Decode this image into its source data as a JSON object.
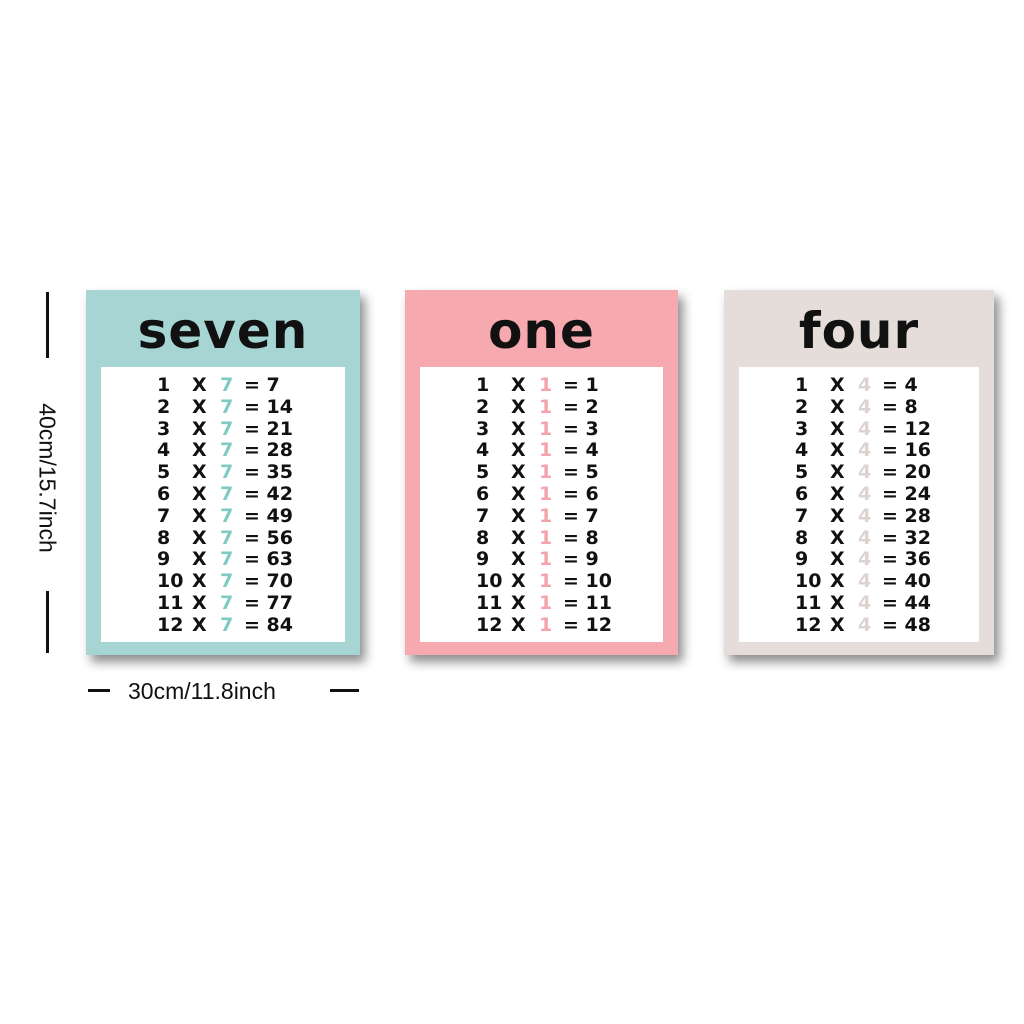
{
  "posters": [
    {
      "title": "seven",
      "bg_color": "#a6d5d3",
      "accent_color": "#7fcac4",
      "rows": [
        {
          "a": "1",
          "x": "X",
          "b": "7",
          "result": "= 7"
        },
        {
          "a": "2",
          "x": "X",
          "b": "7",
          "result": "= 14"
        },
        {
          "a": "3",
          "x": "X",
          "b": "7",
          "result": "= 21"
        },
        {
          "a": "4",
          "x": "X",
          "b": "7",
          "result": "= 28"
        },
        {
          "a": "5",
          "x": "X",
          "b": "7",
          "result": "= 35"
        },
        {
          "a": "6",
          "x": "X",
          "b": "7",
          "result": "= 42"
        },
        {
          "a": "7",
          "x": "X",
          "b": "7",
          "result": "= 49"
        },
        {
          "a": "8",
          "x": "X",
          "b": "7",
          "result": "= 56"
        },
        {
          "a": "9",
          "x": "X",
          "b": "7",
          "result": "= 63"
        },
        {
          "a": "10",
          "x": "X",
          "b": "7",
          "result": "= 70"
        },
        {
          "a": "11",
          "x": "X",
          "b": "7",
          "result": "= 77"
        },
        {
          "a": "12",
          "x": "X",
          "b": "7",
          "result": "= 84"
        }
      ]
    },
    {
      "title": "one",
      "bg_color": "#f7a9b0",
      "accent_color": "#f4a3ab",
      "rows": [
        {
          "a": "1",
          "x": "X",
          "b": "1",
          "result": "= 1"
        },
        {
          "a": "2",
          "x": "X",
          "b": "1",
          "result": "= 2"
        },
        {
          "a": "3",
          "x": "X",
          "b": "1",
          "result": "= 3"
        },
        {
          "a": "4",
          "x": "X",
          "b": "1",
          "result": "= 4"
        },
        {
          "a": "5",
          "x": "X",
          "b": "1",
          "result": "= 5"
        },
        {
          "a": "6",
          "x": "X",
          "b": "1",
          "result": "= 6"
        },
        {
          "a": "7",
          "x": "X",
          "b": "1",
          "result": "= 7"
        },
        {
          "a": "8",
          "x": "X",
          "b": "1",
          "result": "= 8"
        },
        {
          "a": "9",
          "x": "X",
          "b": "1",
          "result": "= 9"
        },
        {
          "a": "10",
          "x": "X",
          "b": "1",
          "result": "= 10"
        },
        {
          "a": "11",
          "x": "X",
          "b": "1",
          "result": "= 11"
        },
        {
          "a": "12",
          "x": "X",
          "b": "1",
          "result": "= 12"
        }
      ]
    },
    {
      "title": "four",
      "bg_color": "#e4ddda",
      "accent_color": "#ddd3d0",
      "rows": [
        {
          "a": "1",
          "x": "X",
          "b": "4",
          "result": "= 4"
        },
        {
          "a": "2",
          "x": "X",
          "b": "4",
          "result": "= 8"
        },
        {
          "a": "3",
          "x": "X",
          "b": "4",
          "result": "= 12"
        },
        {
          "a": "4",
          "x": "X",
          "b": "4",
          "result": "= 16"
        },
        {
          "a": "5",
          "x": "X",
          "b": "4",
          "result": "= 20"
        },
        {
          "a": "6",
          "x": "X",
          "b": "4",
          "result": "= 24"
        },
        {
          "a": "7",
          "x": "X",
          "b": "4",
          "result": "= 28"
        },
        {
          "a": "8",
          "x": "X",
          "b": "4",
          "result": "= 32"
        },
        {
          "a": "9",
          "x": "X",
          "b": "4",
          "result": "= 36"
        },
        {
          "a": "10",
          "x": "X",
          "b": "4",
          "result": "= 40"
        },
        {
          "a": "11",
          "x": "X",
          "b": "4",
          "result": "= 44"
        },
        {
          "a": "12",
          "x": "X",
          "b": "4",
          "result": "= 48"
        }
      ]
    }
  ],
  "dimensions": {
    "height_label": "40cm/15.7inch",
    "width_label": "30cm/11.8inch"
  }
}
